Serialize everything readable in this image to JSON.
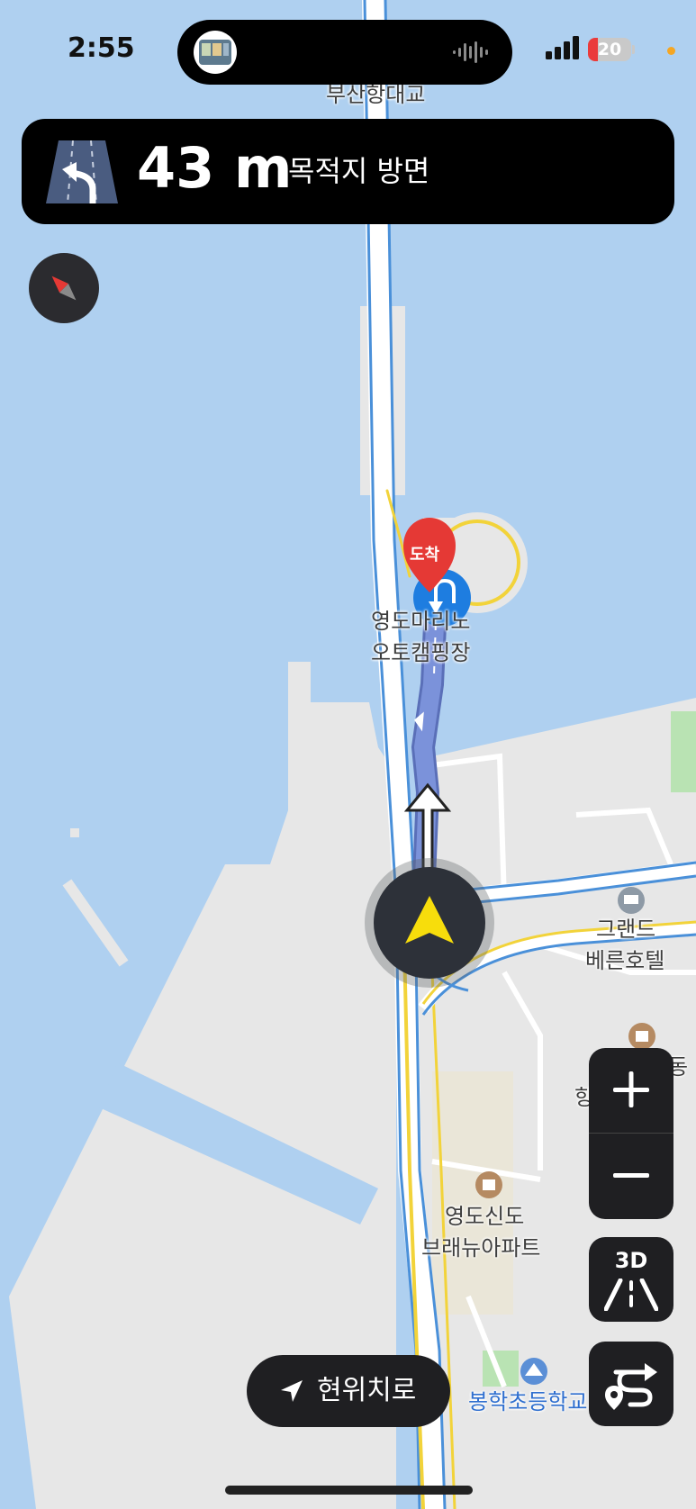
{
  "status_bar": {
    "time": "2:55",
    "battery": "20"
  },
  "navigation": {
    "distance": "43 m",
    "direction": "목적지 방면"
  },
  "map": {
    "labels": {
      "bridge": "부산항대교",
      "destination_pin": "도착",
      "campsite_line1": "영도마리노",
      "campsite_line2": "오토캠핑장",
      "hotel_line1": "그랜드",
      "hotel_line2": "베른호텔",
      "apartment_line1": "영도신도",
      "apartment_line2": "브래뉴아파트",
      "school": "봉학초등학교",
      "partial_line1": "동",
      "partial_line2": "항 센터"
    }
  },
  "controls": {
    "recenter": "현위치로",
    "three_d": "3D",
    "zoom_in_icon": "plus-icon",
    "zoom_out_icon": "minus-icon",
    "route_icon": "route-overview-icon",
    "compass_icon": "compass-icon"
  },
  "colors": {
    "water": "#afd0f0",
    "land": "#e7e7e7",
    "route": "#7b92da",
    "road_blue": "#4a90d9",
    "road_yellow": "#f2d33a",
    "puck_arrow": "#f7dd0c",
    "destination_red": "#e53935"
  }
}
